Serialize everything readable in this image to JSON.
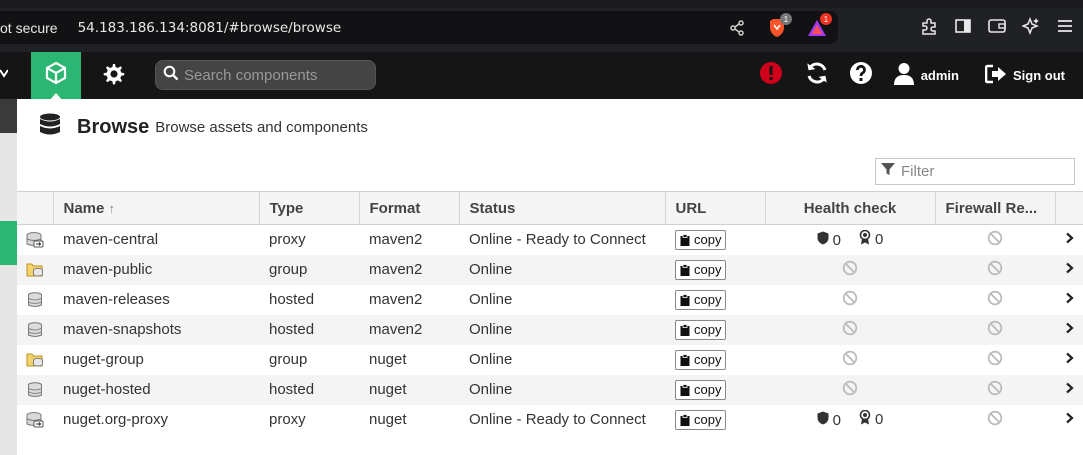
{
  "browser": {
    "security_label": "ot secure",
    "url": "54.183.186.134:8081/#browse/browse",
    "brave_badge": "1",
    "rewards_badge": "1"
  },
  "header": {
    "search_placeholder": "Search components",
    "user_label": "admin",
    "signout_label": "Sign out",
    "accent_color": "#2bb673",
    "alert_color": "#d0021b"
  },
  "page": {
    "title": "Browse",
    "subtitle": "Browse assets and components",
    "filter_placeholder": "Filter"
  },
  "table": {
    "columns": {
      "name": "Name",
      "type": "Type",
      "format": "Format",
      "status": "Status",
      "url": "URL",
      "health": "Health check",
      "firewall": "Firewall Re..."
    },
    "copy_label": "copy",
    "rows": [
      {
        "icon": "proxy-repo-icon",
        "name": "maven-central",
        "type": "proxy",
        "format": "maven2",
        "status": "Online - Ready to Connect",
        "health_a": "0",
        "health_b": "0"
      },
      {
        "icon": "group-repo-icon",
        "name": "maven-public",
        "type": "group",
        "format": "maven2",
        "status": "Online"
      },
      {
        "icon": "hosted-repo-icon",
        "name": "maven-releases",
        "type": "hosted",
        "format": "maven2",
        "status": "Online"
      },
      {
        "icon": "hosted-repo-icon",
        "name": "maven-snapshots",
        "type": "hosted",
        "format": "maven2",
        "status": "Online"
      },
      {
        "icon": "group-repo-icon",
        "name": "nuget-group",
        "type": "group",
        "format": "nuget",
        "status": "Online"
      },
      {
        "icon": "hosted-repo-icon",
        "name": "nuget-hosted",
        "type": "hosted",
        "format": "nuget",
        "status": "Online"
      },
      {
        "icon": "proxy-repo-icon",
        "name": "nuget.org-proxy",
        "type": "proxy",
        "format": "nuget",
        "status": "Online - Ready to Connect",
        "health_a": "0",
        "health_b": "0"
      }
    ]
  }
}
